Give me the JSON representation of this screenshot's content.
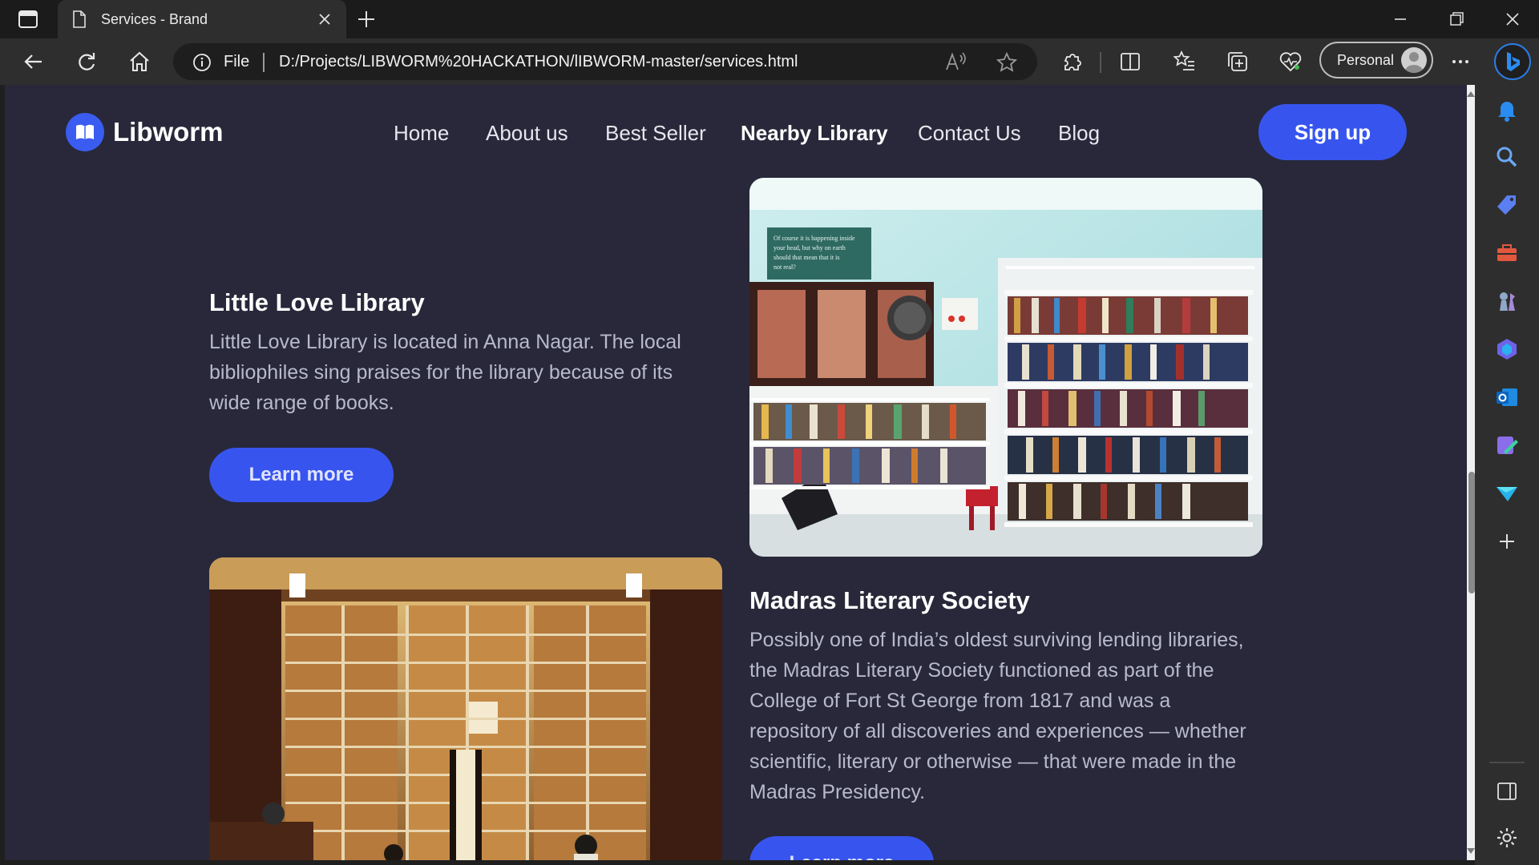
{
  "browser": {
    "tab_title": "Services - Brand",
    "address_scheme": "File",
    "url": "D:/Projects/LIBWORM%20HACKATHON/lIBWORM-master/services.html",
    "profile_label": "Personal"
  },
  "site": {
    "brand": "Libworm",
    "nav": [
      "Home",
      "About us",
      "Best Seller",
      "Nearby Library",
      "Contact Us",
      "Blog"
    ],
    "active_nav": "Nearby Library",
    "signup_label": "Sign up"
  },
  "libraries": [
    {
      "title": "Little Love Library",
      "description": "Little Love Library is located in Anna Nagar. The local bibliophiles sing praises for the library because of its wide range of books.",
      "button": "Learn more",
      "sign_text": "Of course it is happening inside your head, but why on earth should that mean that it is not real?"
    },
    {
      "title": "Madras Literary Society",
      "description": "Possibly one of India’s oldest surviving lending libraries, the Madras Literary Society functioned as part of the College of Fort St George from 1817 and was a repository of all discoveries and experiences — whether scientific, literary or otherwise — that were made in the Madras Presidency.",
      "button": "Learn more"
    }
  ],
  "colors": {
    "page_bg": "#28283a",
    "accent": "#3755ee",
    "chrome_bg": "#2e2e2e"
  }
}
